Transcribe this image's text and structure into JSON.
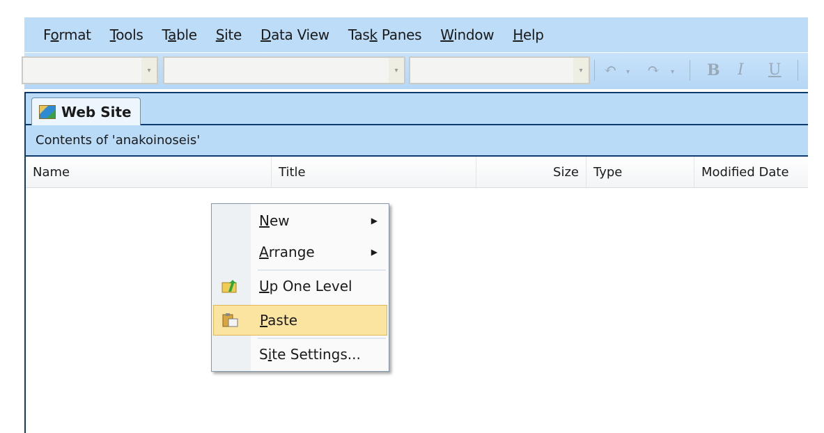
{
  "menubar": {
    "items": [
      {
        "label": "Format",
        "accel": 1
      },
      {
        "label": "Tools",
        "accel": 0
      },
      {
        "label": "Table",
        "accel": 1
      },
      {
        "label": "Site",
        "accel": 0
      },
      {
        "label": "Data View",
        "accel": 0
      },
      {
        "label": "Task Panes",
        "accel": 3
      },
      {
        "label": "Window",
        "accel": 0
      },
      {
        "label": "Help",
        "accel": 0
      }
    ]
  },
  "toolbar": {
    "undo": "↶",
    "redo": "↷",
    "dropdown_arrow": "▾",
    "bold": "B",
    "italic": "I",
    "underline": "U"
  },
  "tab": {
    "label": "Web Site",
    "icon": "web-site-icon"
  },
  "contents_label": "Contents of 'anakoinoseis'",
  "columns": [
    "Name",
    "Title",
    "Size",
    "Type",
    "Modified Date"
  ],
  "context_menu": {
    "items": [
      {
        "label": "New",
        "accel": 0,
        "submenu": true
      },
      {
        "label": "Arrange",
        "accel": 0,
        "submenu": true
      },
      {
        "label": "Up One Level",
        "accel": 0,
        "icon": "up-folder-icon"
      },
      {
        "label": "Paste",
        "accel": 0,
        "icon": "paste-icon",
        "highlighted": true
      },
      {
        "label": "Site Settings...",
        "accel": 1
      }
    ],
    "submenu_arrow": "▶"
  },
  "colors": {
    "menubar": "#bcdcf8",
    "panel_border": "#0c3c6e",
    "highlight": "#fbe3a0"
  }
}
